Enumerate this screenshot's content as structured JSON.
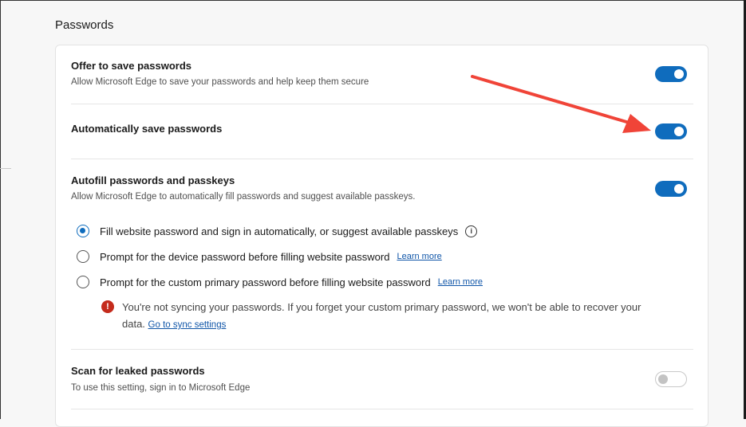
{
  "section": {
    "title": "Passwords"
  },
  "offer_save": {
    "title": "Offer to save passwords",
    "description": "Allow Microsoft Edge to save your passwords and help keep them secure",
    "enabled": true
  },
  "auto_save": {
    "title": "Automatically save passwords",
    "enabled": true
  },
  "autofill": {
    "title": "Autofill passwords and passkeys",
    "description": "Allow Microsoft Edge to automatically fill passwords and suggest available passkeys.",
    "enabled": true,
    "options": [
      {
        "label": "Fill website password and sign in automatically, or suggest available passkeys",
        "selected": true,
        "icon": "info-icon"
      },
      {
        "label": "Prompt for the device password before filling website password",
        "selected": false,
        "link": "Learn more"
      },
      {
        "label": "Prompt for the custom primary password before filling website password",
        "selected": false,
        "link": "Learn more"
      }
    ],
    "warning": {
      "text": "You're not syncing your passwords. If you forget your custom primary password, we won't be able to recover your data.",
      "link": "Go to sync settings",
      "icon": "error-icon"
    }
  },
  "scan_leaked": {
    "title": "Scan for leaked passwords",
    "description": "To use this setting, sign in to Microsoft Edge",
    "enabled": false
  },
  "annotation": {
    "color": "#f04438",
    "icon": "red-arrow"
  }
}
